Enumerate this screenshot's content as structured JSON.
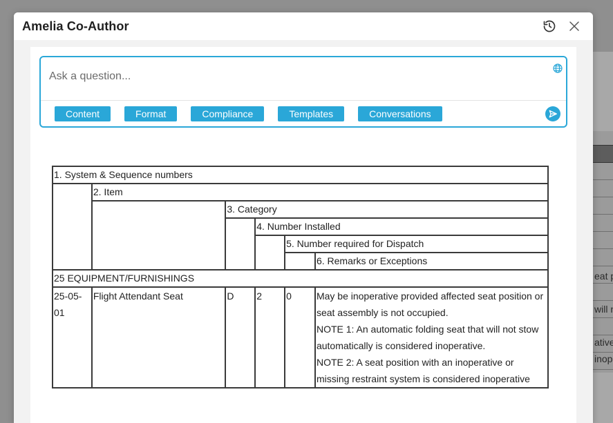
{
  "modal": {
    "title": "Amelia Co-Author"
  },
  "ask": {
    "placeholder": "Ask a question...",
    "chips": [
      "Content",
      "Format",
      "Compliance",
      "Templates",
      "Conversations"
    ]
  },
  "icons": {
    "history": "history-icon",
    "close": "close-icon",
    "globe": "globe-icon",
    "send": "send-icon"
  },
  "colors": {
    "accent": "#2aa7d8",
    "overlay": "#8f8f8f"
  },
  "table": {
    "h1": "1. System & Sequence numbers",
    "h2": "2. Item",
    "h3": "3. Category",
    "h4": "4. Number Installed",
    "h5": "5. Number required for Dispatch",
    "h6": "6. Remarks or Exceptions",
    "section": "25 EQUIPMENT/FURNISHINGS",
    "row": {
      "seq": "25-05-01",
      "item": "Flight Attendant Seat",
      "category": "D",
      "installed": "2",
      "required": "0",
      "remarks": [
        "May be inoperative provided affected seat position or seat assembly is not occupied.",
        "NOTE 1: An automatic folding seat that will not stow automatically is considered inoperative.",
        "NOTE 2: A seat position with an inoperative or missing restraint system is considered inoperative"
      ]
    }
  },
  "background": {
    "snippets": [
      "eat po",
      "will n",
      "ative",
      "inope"
    ]
  }
}
